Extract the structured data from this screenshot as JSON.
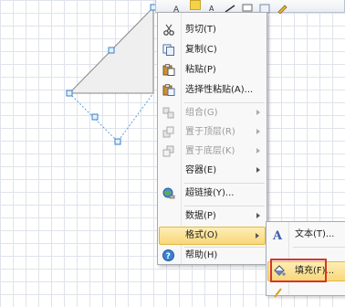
{
  "menu": {
    "items": [
      {
        "label": "剪切(T)",
        "icon": "scissors-icon",
        "disabled": false,
        "submenu": false,
        "highlighted": false
      },
      {
        "label": "复制(C)",
        "icon": "copy-icon",
        "disabled": false,
        "submenu": false,
        "highlighted": false
      },
      {
        "label": "粘贴(P)",
        "icon": "paste-icon",
        "disabled": false,
        "submenu": false,
        "highlighted": false
      },
      {
        "label": "选择性粘贴(A)...",
        "icon": "paste-special-icon",
        "disabled": false,
        "submenu": false,
        "highlighted": false
      },
      {
        "label": "组合(G)",
        "icon": "group-icon",
        "disabled": true,
        "submenu": true,
        "highlighted": false
      },
      {
        "label": "置于顶层(R)",
        "icon": "bring-to-front-icon",
        "disabled": true,
        "submenu": true,
        "highlighted": false
      },
      {
        "label": "置于底层(K)",
        "icon": "send-to-back-icon",
        "disabled": true,
        "submenu": true,
        "highlighted": false
      },
      {
        "label": "容器(E)",
        "icon": "",
        "disabled": false,
        "submenu": true,
        "highlighted": false
      },
      {
        "label": "超链接(Y)...",
        "icon": "hyperlink-globe-icon",
        "disabled": false,
        "submenu": false,
        "highlighted": false
      },
      {
        "label": "数据(P)",
        "icon": "",
        "disabled": false,
        "submenu": true,
        "highlighted": false
      },
      {
        "label": "格式(O)",
        "icon": "",
        "disabled": false,
        "submenu": true,
        "highlighted": true
      },
      {
        "label": "帮助(H)",
        "icon": "help-icon",
        "disabled": false,
        "submenu": false,
        "highlighted": false
      }
    ]
  },
  "submenu": {
    "items": [
      {
        "label": "文本(T)...",
        "icon": "text-a-icon",
        "highlighted": false
      },
      {
        "label": "填充(F)...",
        "icon": "fill-bucket-icon",
        "highlighted": true
      },
      {
        "label": "",
        "icon": "",
        "highlighted": false
      }
    ]
  },
  "colors": {
    "highlight": "#f8d77a",
    "highlight_border": "#e3b745",
    "annotation_box": "#d8342a",
    "grid": "#dfe3ea",
    "shape_fill": "#efefef",
    "handle": "#5fa0d8"
  }
}
